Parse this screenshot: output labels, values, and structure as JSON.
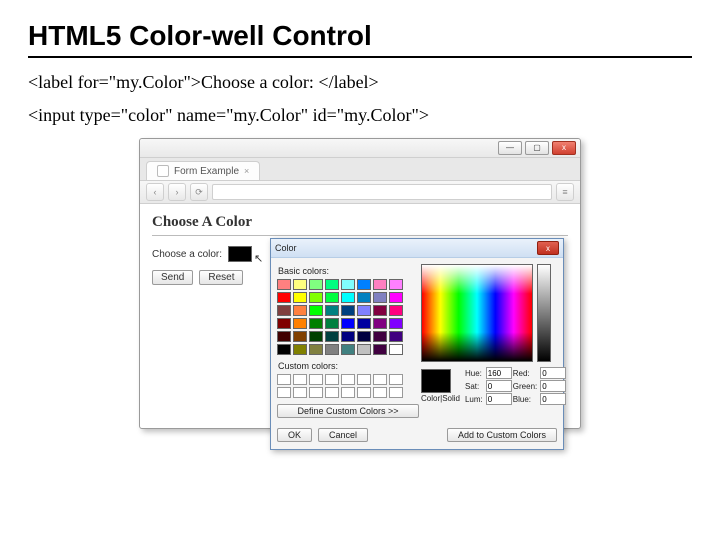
{
  "heading": "HTML5 Color-well Control",
  "code1": "<label for=\"my.Color\">Choose a color: </label>",
  "code2": "<input type=\"color\" name=\"my.Color\" id=\"my.Color\">",
  "browser": {
    "tab_title": "Form Example",
    "win_min": "—",
    "win_max": "▢",
    "win_close": "x",
    "nav_back": "‹",
    "nav_fwd": "›",
    "nav_reload": "⟳",
    "page_heading": "Choose A Color",
    "label": "Choose a color:",
    "send": "Send",
    "reset": "Reset"
  },
  "dialog": {
    "title": "Color",
    "close": "x",
    "basic_label": "Basic colors:",
    "custom_label": "Custom colors:",
    "define": "Define Custom Colors >>",
    "ok": "OK",
    "cancel": "Cancel",
    "add": "Add to Custom Colors",
    "hue_l": "Hue:",
    "hue_v": "160",
    "sat_l": "Sat:",
    "sat_v": "0",
    "lum_l": "Lum:",
    "lum_v": "0",
    "red_l": "Red:",
    "red_v": "0",
    "grn_l": "Green:",
    "grn_v": "0",
    "blu_l": "Blue:",
    "blu_v": "0",
    "solid": "Color|Solid",
    "basic_colors": [
      "#ff8080",
      "#ffff80",
      "#80ff80",
      "#00ff80",
      "#80ffff",
      "#0080ff",
      "#ff80c0",
      "#ff80ff",
      "#ff0000",
      "#ffff00",
      "#80ff00",
      "#00ff40",
      "#00ffff",
      "#0080c0",
      "#8080c0",
      "#ff00ff",
      "#804040",
      "#ff8040",
      "#00ff00",
      "#008080",
      "#004080",
      "#8080ff",
      "#800040",
      "#ff0080",
      "#800000",
      "#ff8000",
      "#008000",
      "#008040",
      "#0000ff",
      "#0000a0",
      "#800080",
      "#8000ff",
      "#400000",
      "#804000",
      "#004000",
      "#004040",
      "#000080",
      "#000040",
      "#400040",
      "#400080",
      "#000000",
      "#808000",
      "#808040",
      "#808080",
      "#408080",
      "#c0c0c0",
      "#400040",
      "#ffffff"
    ]
  }
}
